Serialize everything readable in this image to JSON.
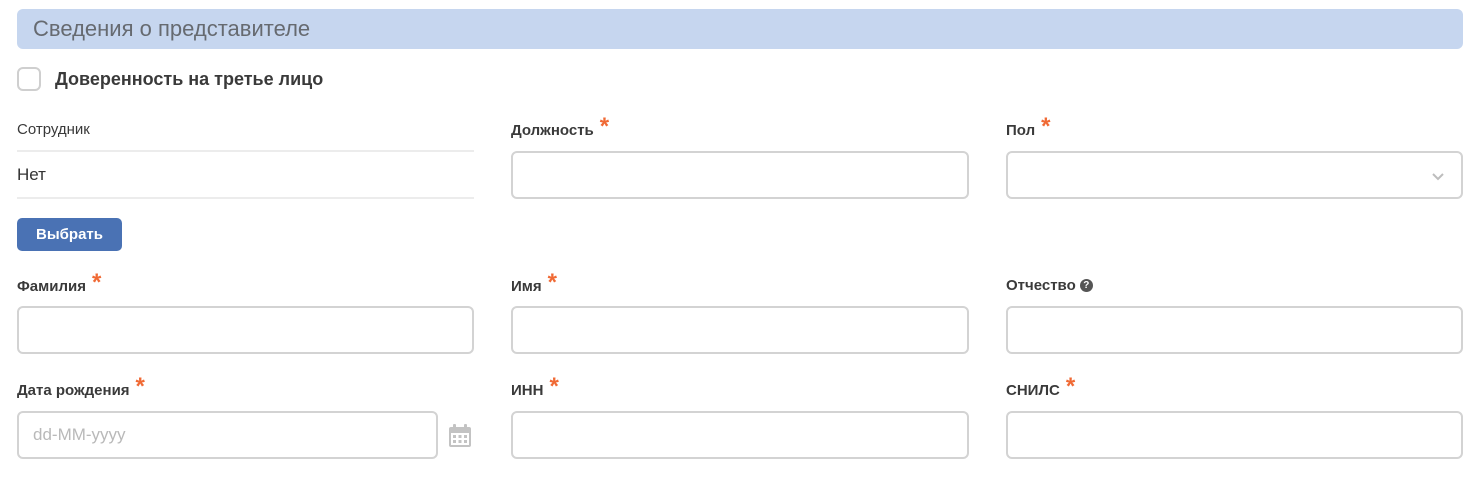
{
  "section": {
    "title": "Сведения о представителе"
  },
  "proxy_checkbox": {
    "label": "Доверенность на третье лицо",
    "checked": false
  },
  "employee": {
    "label": "Сотрудник",
    "value": "Нет",
    "select_button": "Выбрать"
  },
  "position": {
    "label": "Должность",
    "required_mark": "*",
    "value": ""
  },
  "gender": {
    "label": "Пол",
    "required_mark": "*",
    "value": ""
  },
  "last_name": {
    "label": "Фамилия",
    "required_mark": "*",
    "value": ""
  },
  "first_name": {
    "label": "Имя",
    "required_mark": "*",
    "value": ""
  },
  "middle_name": {
    "label": "Отчество",
    "help_icon": "?",
    "value": ""
  },
  "birth_date": {
    "label": "Дата рождения",
    "required_mark": "*",
    "placeholder": "dd-MM-yyyy",
    "value": ""
  },
  "inn": {
    "label": "ИНН",
    "required_mark": "*",
    "value": ""
  },
  "snils": {
    "label": "СНИЛС",
    "required_mark": "*",
    "value": ""
  },
  "colors": {
    "header_bg": "#c6d6ef",
    "button_bg": "#4a72b4",
    "required": "#f06a35"
  },
  "icons": {
    "gender_dropdown": "chevron-down-icon",
    "middle_name_help": "help-icon",
    "birth_date_picker": "calendar-icon"
  }
}
